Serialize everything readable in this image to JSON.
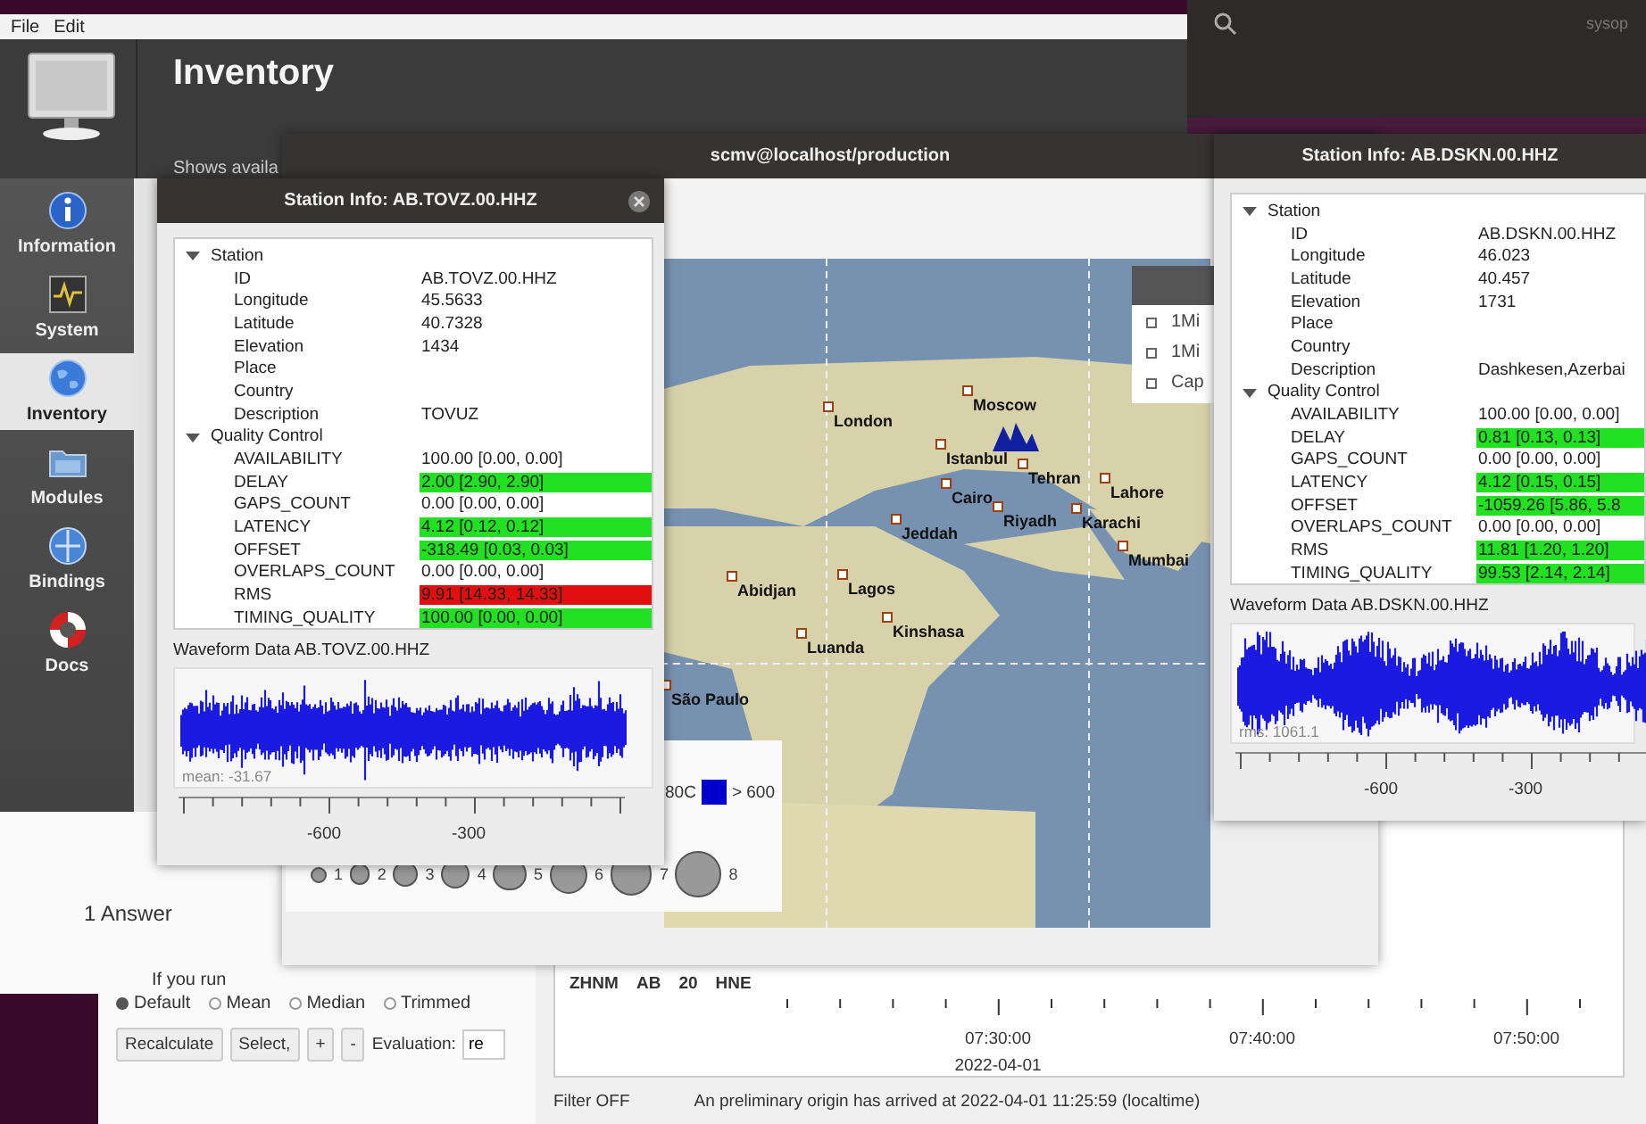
{
  "terminal": {
    "title": "sysop"
  },
  "config": {
    "menu": [
      "File",
      "Edit"
    ],
    "title": "Inventory",
    "subtitle": "Shows availa",
    "sidebar": [
      {
        "label": "Information",
        "selected": false
      },
      {
        "label": "System",
        "selected": false
      },
      {
        "label": "Inventory",
        "selected": true
      },
      {
        "label": "Modules",
        "selected": false
      },
      {
        "label": "Bindings",
        "selected": false
      },
      {
        "label": "Docs",
        "selected": false
      }
    ]
  },
  "webpage": {
    "answers": "1 Answer",
    "text": "If you run"
  },
  "origin_locator": {
    "methods": [
      {
        "label": "Default",
        "selected": true
      },
      {
        "label": "Mean",
        "selected": false
      },
      {
        "label": "Median",
        "selected": false
      },
      {
        "label": "Trimmed",
        "selected": false
      }
    ],
    "buttons": [
      "Recalculate",
      "Select,",
      "+",
      "-"
    ],
    "evaluation_label": "Evaluation:",
    "evaluation_value": "re",
    "trace": [
      "ZHNM",
      "AB",
      "20",
      "HNE"
    ],
    "time_ticks": [
      {
        "time": "07:30:00",
        "date": "2022-04-01"
      },
      {
        "time": "07:40:00"
      },
      {
        "time": "07:50:00"
      }
    ],
    "status": {
      "filter": "Filter OFF",
      "message": "An preliminary origin has arrived at 2022-04-01 11:25:59 (localtime)"
    }
  },
  "map_window": {
    "title": "scmv@localhost/production",
    "cities": [
      "Moscow",
      "London",
      "Istanbul",
      "Tehran",
      "Lahore",
      "Cairo",
      "Riyadh",
      "Karachi",
      "Jeddah",
      "Mumbai",
      "Abidjan",
      "Lagos",
      "Kinshasa",
      "Luanda",
      "São Paulo"
    ],
    "legend": [
      "1Mi",
      "1Mi",
      "Cap"
    ],
    "depth_legend": [
      {
        "label": "80C"
      },
      {
        "label": "> 600",
        "color": "#0000cc"
      }
    ],
    "magnitudes": [
      "1",
      "2",
      "3",
      "4",
      "5",
      "6",
      "7",
      "8"
    ]
  },
  "station_windows": [
    {
      "title": "Station Info: AB.TOVZ.00.HHZ",
      "tree": [
        {
          "label": "Station",
          "expanded": true,
          "children": [
            {
              "name": "ID",
              "value": "AB.TOVZ.00.HHZ"
            },
            {
              "name": "Longitude",
              "value": "45.5633"
            },
            {
              "name": "Latitude",
              "value": "40.7328"
            },
            {
              "name": "Elevation",
              "value": "1434"
            },
            {
              "name": "Place"
            },
            {
              "name": "Country"
            },
            {
              "name": "Description",
              "value": "TOVUZ"
            }
          ]
        },
        {
          "label": "Quality Control",
          "expanded": true,
          "children": [
            {
              "name": "AVAILABILITY",
              "value": "100.00 [0.00, 0.00]"
            },
            {
              "name": "DELAY",
              "value": "2.00 [2.90, 2.90]",
              "color": "#22e022"
            },
            {
              "name": "GAPS_COUNT",
              "value": "0.00 [0.00, 0.00]"
            },
            {
              "name": "LATENCY",
              "value": "4.12 [0.12, 0.12]",
              "color": "#22e022"
            },
            {
              "name": "OFFSET",
              "value": "-318.49 [0.03, 0.03]",
              "color": "#22e022"
            },
            {
              "name": "OVERLAPS_COUNT",
              "value": "0.00 [0.00, 0.00]"
            },
            {
              "name": "RMS",
              "value": "9.91 [14.33, 14.33]",
              "color": "#e01010"
            },
            {
              "name": "TIMING_QUALITY",
              "value": "100.00 [0.00, 0.00]",
              "color": "#22e022"
            }
          ]
        }
      ],
      "waveform": {
        "title": "Waveform Data AB.TOVZ.00.HHZ",
        "stat": "mean: -31.67",
        "ticks": [
          "-600",
          "-300"
        ]
      }
    },
    {
      "title": "Station Info: AB.DSKN.00.HHZ",
      "tree": [
        {
          "label": "Station",
          "expanded": true,
          "children": [
            {
              "name": "ID",
              "value": "AB.DSKN.00.HHZ"
            },
            {
              "name": "Longitude",
              "value": "46.023"
            },
            {
              "name": "Latitude",
              "value": "40.457"
            },
            {
              "name": "Elevation",
              "value": "1731"
            },
            {
              "name": "Place"
            },
            {
              "name": "Country"
            },
            {
              "name": "Description",
              "value": "Dashkesen,Azerbai"
            }
          ]
        },
        {
          "label": "Quality Control",
          "expanded": true,
          "children": [
            {
              "name": "AVAILABILITY",
              "value": "100.00 [0.00, 0.00]"
            },
            {
              "name": "DELAY",
              "value": "0.81 [0.13, 0.13]",
              "color": "#22e022"
            },
            {
              "name": "GAPS_COUNT",
              "value": "0.00 [0.00, 0.00]"
            },
            {
              "name": "LATENCY",
              "value": "4.12 [0.15, 0.15]",
              "color": "#22e022"
            },
            {
              "name": "OFFSET",
              "value": "-1059.26 [5.86, 5.8",
              "color": "#22e022"
            },
            {
              "name": "OVERLAPS_COUNT",
              "value": "0.00 [0.00, 0.00]"
            },
            {
              "name": "RMS",
              "value": "11.81 [1.20, 1.20]",
              "color": "#22e022"
            },
            {
              "name": "TIMING_QUALITY",
              "value": "99.53 [2.14, 2.14]",
              "color": "#22e022"
            }
          ]
        }
      ],
      "waveform": {
        "title": "Waveform Data AB.DSKN.00.HHZ",
        "stat": "rms: 1061.1",
        "ticks": [
          "-600",
          "-300"
        ]
      }
    }
  ]
}
